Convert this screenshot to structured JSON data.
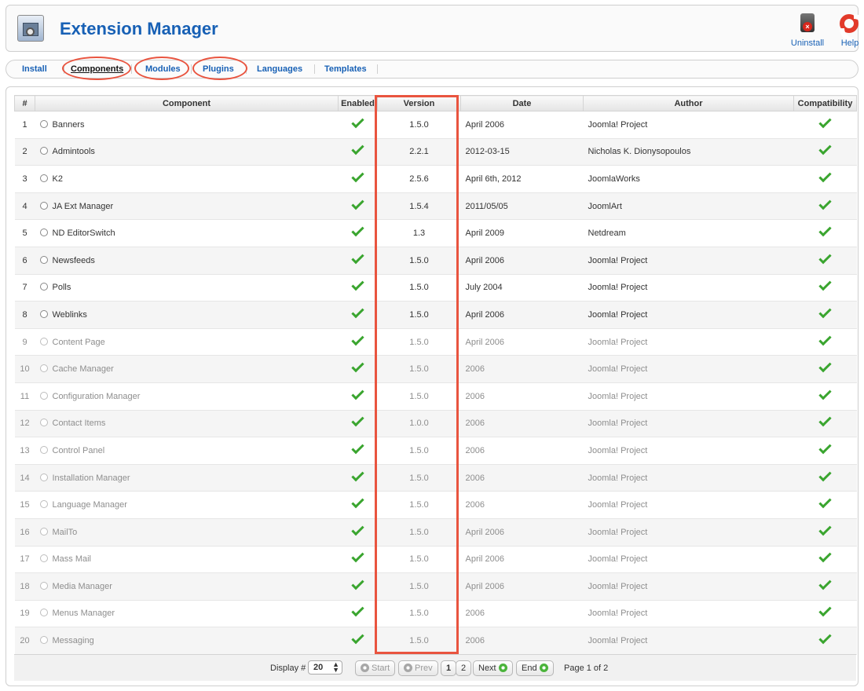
{
  "header": {
    "title": "Extension Manager",
    "logo_icon": "extension-box-icon",
    "toolbar": [
      {
        "label": "Uninstall",
        "icon": "trash-icon"
      },
      {
        "label": "Help",
        "icon": "lifebuoy-icon"
      }
    ]
  },
  "submenu": {
    "items": [
      "Install",
      "Components",
      "Modules",
      "Plugins",
      "Languages",
      "Templates"
    ],
    "active": "Components"
  },
  "table": {
    "columns": [
      "#",
      "Component",
      "Enabled",
      "Version",
      "Date",
      "Author",
      "Compatibility"
    ],
    "rows": [
      {
        "num": "1",
        "name": "Banners",
        "version": "1.5.0",
        "date": "April 2006",
        "author": "Joomla! Project",
        "enabled": true,
        "compatible": true,
        "core": false
      },
      {
        "num": "2",
        "name": "Admintools",
        "version": "2.2.1",
        "date": "2012-03-15",
        "author": "Nicholas K. Dionysopoulos",
        "enabled": true,
        "compatible": true,
        "core": false
      },
      {
        "num": "3",
        "name": "K2",
        "version": "2.5.6",
        "date": "April 6th, 2012",
        "author": "JoomlaWorks",
        "enabled": true,
        "compatible": true,
        "core": false
      },
      {
        "num": "4",
        "name": "JA Ext Manager",
        "version": "1.5.4",
        "date": "2011/05/05",
        "author": "JoomlArt",
        "enabled": true,
        "compatible": true,
        "core": false
      },
      {
        "num": "5",
        "name": "ND EditorSwitch",
        "version": "1.3",
        "date": "April 2009",
        "author": "Netdream",
        "enabled": true,
        "compatible": true,
        "core": false
      },
      {
        "num": "6",
        "name": "Newsfeeds",
        "version": "1.5.0",
        "date": "April 2006",
        "author": "Joomla! Project",
        "enabled": true,
        "compatible": true,
        "core": false
      },
      {
        "num": "7",
        "name": "Polls",
        "version": "1.5.0",
        "date": "July 2004",
        "author": "Joomla! Project",
        "enabled": true,
        "compatible": true,
        "core": false
      },
      {
        "num": "8",
        "name": "Weblinks",
        "version": "1.5.0",
        "date": "April 2006",
        "author": "Joomla! Project",
        "enabled": true,
        "compatible": true,
        "core": false
      },
      {
        "num": "9",
        "name": "Content Page",
        "version": "1.5.0",
        "date": "April 2006",
        "author": "Joomla! Project",
        "enabled": true,
        "compatible": true,
        "core": true
      },
      {
        "num": "10",
        "name": "Cache Manager",
        "version": "1.5.0",
        "date": "2006",
        "author": "Joomla! Project",
        "enabled": true,
        "compatible": true,
        "core": true
      },
      {
        "num": "11",
        "name": "Configuration Manager",
        "version": "1.5.0",
        "date": "2006",
        "author": "Joomla! Project",
        "enabled": true,
        "compatible": true,
        "core": true
      },
      {
        "num": "12",
        "name": "Contact Items",
        "version": "1.0.0",
        "date": "2006",
        "author": "Joomla! Project",
        "enabled": true,
        "compatible": true,
        "core": true
      },
      {
        "num": "13",
        "name": "Control Panel",
        "version": "1.5.0",
        "date": "2006",
        "author": "Joomla! Project",
        "enabled": true,
        "compatible": true,
        "core": true
      },
      {
        "num": "14",
        "name": "Installation Manager",
        "version": "1.5.0",
        "date": "2006",
        "author": "Joomla! Project",
        "enabled": true,
        "compatible": true,
        "core": true
      },
      {
        "num": "15",
        "name": "Language Manager",
        "version": "1.5.0",
        "date": "2006",
        "author": "Joomla! Project",
        "enabled": true,
        "compatible": true,
        "core": true
      },
      {
        "num": "16",
        "name": "MailTo",
        "version": "1.5.0",
        "date": "April 2006",
        "author": "Joomla! Project",
        "enabled": true,
        "compatible": true,
        "core": true
      },
      {
        "num": "17",
        "name": "Mass Mail",
        "version": "1.5.0",
        "date": "April 2006",
        "author": "Joomla! Project",
        "enabled": true,
        "compatible": true,
        "core": true
      },
      {
        "num": "18",
        "name": "Media Manager",
        "version": "1.5.0",
        "date": "April 2006",
        "author": "Joomla! Project",
        "enabled": true,
        "compatible": true,
        "core": true
      },
      {
        "num": "19",
        "name": "Menus Manager",
        "version": "1.5.0",
        "date": "2006",
        "author": "Joomla! Project",
        "enabled": true,
        "compatible": true,
        "core": true
      },
      {
        "num": "20",
        "name": "Messaging",
        "version": "1.5.0",
        "date": "2006",
        "author": "Joomla! Project",
        "enabled": true,
        "compatible": true,
        "core": true
      }
    ]
  },
  "pagination": {
    "display_label": "Display #",
    "limit": "20",
    "start": "Start",
    "prev": "Prev",
    "pages": [
      "1",
      "2"
    ],
    "next": "Next",
    "end": "End",
    "page_info": "Page 1 of 2"
  },
  "colors": {
    "link": "#1760b5",
    "check": "#3aa52f",
    "annotation": "#e9543f"
  }
}
